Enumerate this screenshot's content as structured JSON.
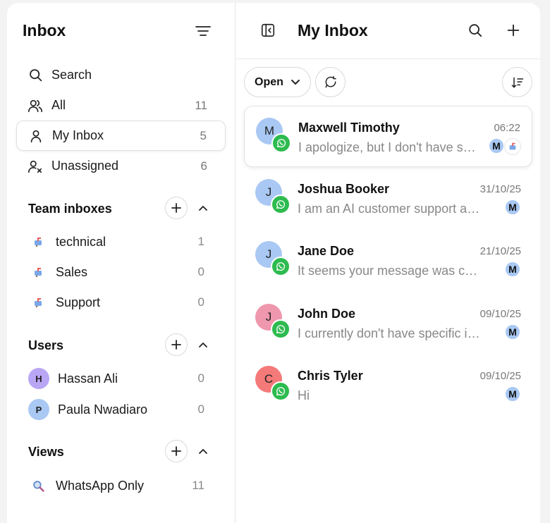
{
  "colors": {
    "accent_green": "#2dbb4f",
    "avatar_blue": "#a9c8f3",
    "avatar_pink": "#ef98ad",
    "avatar_red": "#f47979",
    "avatar_purple": "#b9a6f5"
  },
  "sidebar": {
    "title": "Inbox",
    "nav": [
      {
        "label": "Search",
        "count": "",
        "icon": "search-icon"
      },
      {
        "label": "All",
        "count": "11",
        "icon": "users-icon"
      },
      {
        "label": "My Inbox",
        "count": "5",
        "icon": "user-icon",
        "active": true
      },
      {
        "label": "Unassigned",
        "count": "6",
        "icon": "user-x-icon"
      }
    ],
    "team_inboxes": {
      "title": "Team inboxes",
      "items": [
        {
          "label": "technical",
          "count": "1"
        },
        {
          "label": "Sales",
          "count": "0"
        },
        {
          "label": "Support",
          "count": "0"
        }
      ]
    },
    "users": {
      "title": "Users",
      "items": [
        {
          "initial": "H",
          "label": "Hassan Ali",
          "count": "0",
          "color": "#b9a6f5"
        },
        {
          "initial": "P",
          "label": "Paula Nwadiaro",
          "count": "0",
          "color": "#a9c8f3"
        }
      ]
    },
    "views": {
      "title": "Views",
      "items": [
        {
          "label": "WhatsApp Only",
          "count": "11"
        }
      ]
    }
  },
  "main": {
    "title": "My Inbox",
    "status_filter": "Open",
    "conversations": [
      {
        "initial": "M",
        "name": "Maxwell Timothy",
        "time": "06:22",
        "message": "I apologize, but I don't have specific information",
        "agent": "M",
        "avatar_color": "#a9c8f3",
        "active": true
      },
      {
        "initial": "J",
        "name": "Joshua Booker",
        "time": "31/10/25",
        "message": "I am an AI customer support assistant",
        "agent": "M",
        "avatar_color": "#a9c8f3"
      },
      {
        "initial": "J",
        "name": "Jane Doe",
        "time": "21/10/25",
        "message": "It seems your message was cut off",
        "agent": "M",
        "avatar_color": "#a9c8f3"
      },
      {
        "initial": "J",
        "name": "John Doe",
        "time": "09/10/25",
        "message": "I currently don't have specific information",
        "agent": "M",
        "avatar_color": "#ef98ad"
      },
      {
        "initial": "C",
        "name": "Chris Tyler",
        "time": "09/10/25",
        "message": "Hi",
        "agent": "M",
        "avatar_color": "#f47979"
      }
    ]
  }
}
